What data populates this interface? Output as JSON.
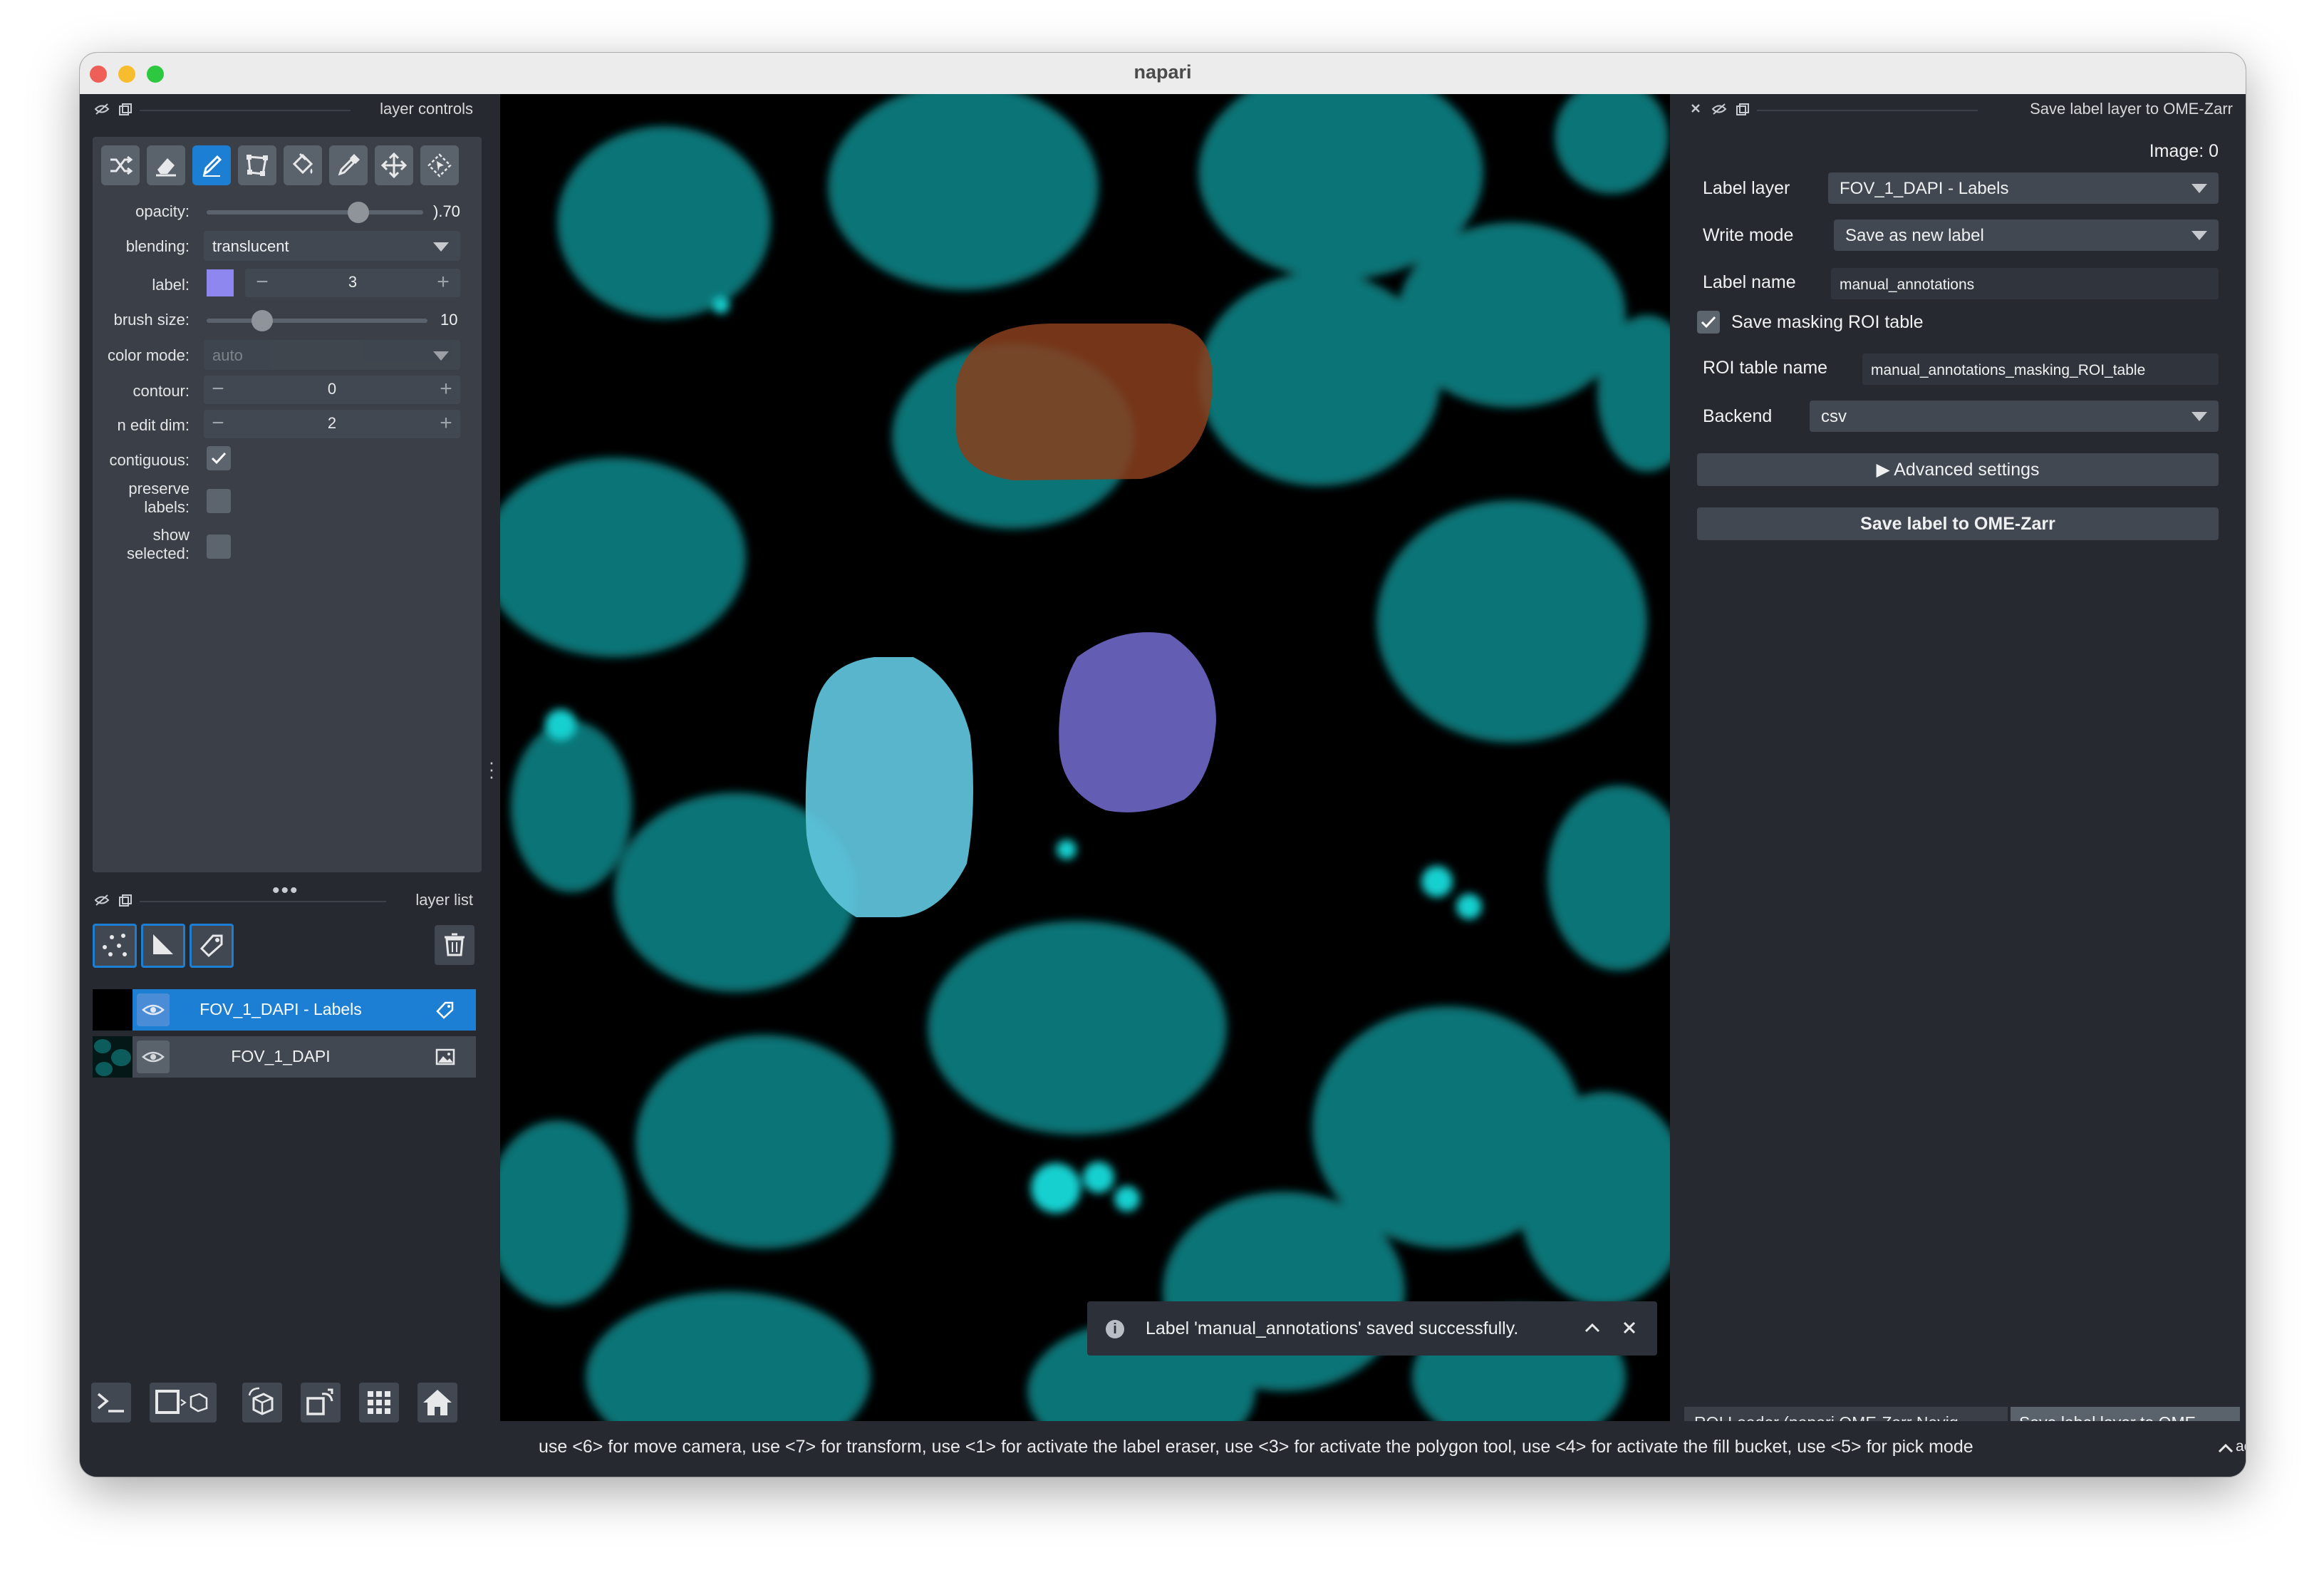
{
  "window": {
    "title": "napari"
  },
  "layer_controls": {
    "header": "layer controls",
    "opacity": {
      "label": "opacity:",
      "value_text": ").70",
      "value": 0.7
    },
    "blending": {
      "label": "blending:",
      "value": "translucent"
    },
    "label": {
      "label": "label:",
      "value": "3",
      "swatch_color": "#8f87f0"
    },
    "brush_size": {
      "label": "brush size:",
      "value_text": "10",
      "value": 10,
      "max": 40
    },
    "color_mode": {
      "label": "color mode:",
      "value": "auto"
    },
    "contour": {
      "label": "contour:",
      "value": "0"
    },
    "n_edit_dim": {
      "label": "n edit dim:",
      "value": "2"
    },
    "contiguous": {
      "label": "contiguous:",
      "checked": true
    },
    "preserve_labels": {
      "label_line1": "preserve",
      "label_line2": "labels:",
      "checked": false
    },
    "show_selected": {
      "label_line1": "show",
      "label_line2": "selected:",
      "checked": false
    },
    "tools": [
      "shuffle-icon",
      "eraser-icon",
      "paint-brush-icon",
      "polygon-icon",
      "fill-bucket-icon",
      "color-picker-icon",
      "move-camera-icon",
      "transform-icon"
    ],
    "active_tool": "paint-brush-icon"
  },
  "layer_list": {
    "header": "layer list",
    "new_layer_buttons": [
      "new-points-icon",
      "new-shapes-icon",
      "new-labels-icon"
    ],
    "layers": [
      {
        "name": "FOV_1_DAPI - Labels",
        "selected": true,
        "type_icon": "label-tag-icon"
      },
      {
        "name": "FOV_1_DAPI",
        "selected": false,
        "type_icon": "image-icon"
      }
    ]
  },
  "bottom_buttons": [
    "console-icon",
    "ndisplay-toggle-icon",
    "roll-dims-icon",
    "transpose-icon",
    "grid-icon",
    "home-icon"
  ],
  "notification": {
    "text": "Label 'manual_annotations' saved successfully."
  },
  "right_panel": {
    "header": "Save label layer to OME-Zarr",
    "image_label": "Image: 0",
    "label_layer": {
      "label": "Label layer",
      "value": "FOV_1_DAPI - Labels"
    },
    "write_mode": {
      "label": "Write mode",
      "value": "Save as new label"
    },
    "label_name": {
      "label": "Label name",
      "value": "manual_annotations"
    },
    "save_masking": {
      "label": "Save masking ROI table",
      "checked": true
    },
    "roi_table_name": {
      "label": "ROI table name",
      "value": "manual_annotations_masking_ROI_table"
    },
    "backend": {
      "label": "Backend",
      "value": "csv"
    },
    "advanced_button": "▶ Advanced settings",
    "save_button": "Save label to OME-Zarr"
  },
  "dock_tabs": [
    "ROI Loader (napari OME-Zarr Navig...",
    "Save label layer to OME-..."
  ],
  "status": {
    "text": "use <6> for move camera, use <7> for transform, use <1> for activate the label eraser, use <3> for activate the polygon tool, use <4> for activate the fill bucket, use <5> for pick mode",
    "activity": "activity"
  },
  "colors": {
    "accent": "#1d7fd3",
    "nuclei": "#0f8a8a",
    "label_orange": "#8a3e1c",
    "label_cyan": "#5fc4dc",
    "label_purple": "#6e67c8"
  }
}
